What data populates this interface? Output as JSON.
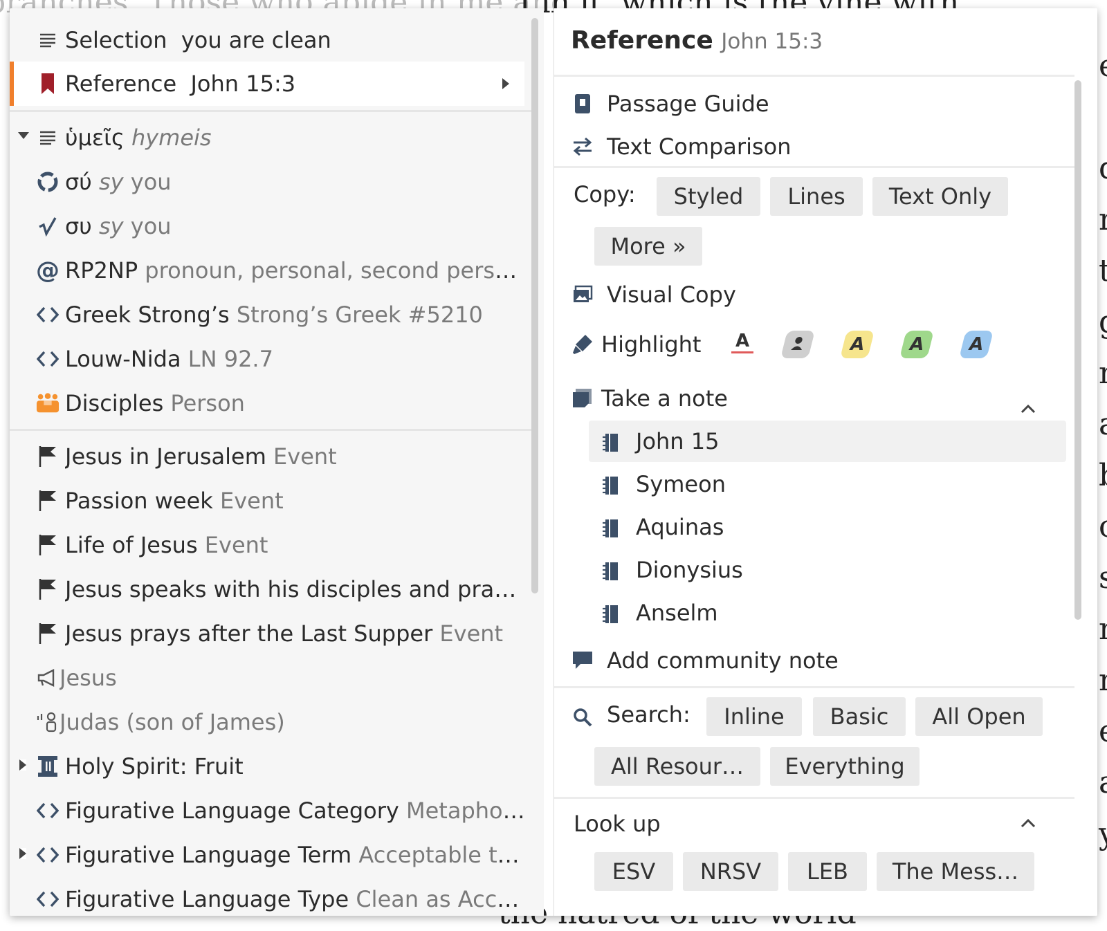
{
  "background": {
    "top_left": "branches. Those who abide in me and",
    "top_right": "I in it, which is the vine with",
    "bottom": "the hatred of the world",
    "right_letters": [
      "e",
      "",
      "d",
      "n",
      "t",
      "g",
      "n",
      "a",
      "b",
      "c",
      "s",
      "n",
      "n",
      "e",
      "a",
      "y"
    ]
  },
  "left_panel": {
    "header_items": [
      {
        "icon": "lines-icon",
        "label": "Selection",
        "secondary": "you are clean"
      },
      {
        "icon": "bookmark-icon",
        "label": "Reference",
        "secondary": "John 15:3",
        "has_submenu": true,
        "selected": true
      }
    ],
    "word_group": {
      "label": "ὑμεῖς",
      "secondary": "hymeis",
      "expanded": true,
      "items": [
        {
          "icon": "lemma-icon",
          "label": "σύ",
          "secondary": "sy",
          "gloss": "you"
        },
        {
          "icon": "root-icon",
          "label": "συ",
          "secondary": "sy",
          "gloss": "you"
        },
        {
          "icon": "at-icon",
          "label": "RP2NP",
          "secondary": "pronoun, personal, second person…"
        },
        {
          "icon": "code-icon",
          "label": "Greek Strong’s",
          "secondary": "Strong’s Greek #5210"
        },
        {
          "icon": "code-icon",
          "label": "Louw-Nida",
          "secondary": "LN 92.7"
        },
        {
          "icon": "people-icon",
          "label": "Disciples",
          "secondary": "Person"
        }
      ]
    },
    "events": [
      {
        "icon": "flag-icon",
        "label": "Jesus in Jerusalem",
        "secondary": "Event"
      },
      {
        "icon": "flag-icon",
        "label": "Passion week",
        "secondary": "Event"
      },
      {
        "icon": "flag-icon",
        "label": "Life of Jesus",
        "secondary": "Event"
      },
      {
        "icon": "flag-icon",
        "label": "Jesus speaks with his disciples and prays…",
        "secondary": ""
      },
      {
        "icon": "flag-icon",
        "label": "Jesus prays after the Last Supper",
        "secondary": "Event"
      }
    ],
    "others": [
      {
        "icon": "megaphone-icon",
        "label": "Jesus",
        "secondary": "",
        "muted": true
      },
      {
        "icon": "speaker-person-icon",
        "label": "Judas (son of James)",
        "secondary": "",
        "muted": true
      },
      {
        "icon": "pillar-icon",
        "label": "Holy Spirit: Fruit",
        "secondary": "",
        "collapsed": true
      },
      {
        "icon": "code-icon",
        "label": "Figurative Language Category",
        "secondary": "Metaphor,…"
      },
      {
        "icon": "code-icon",
        "label": "Figurative Language Term",
        "secondary": "Acceptable to…",
        "collapsed": true
      },
      {
        "icon": "code-icon",
        "label": "Figurative Language Type",
        "secondary": "Clean as Accept…"
      }
    ]
  },
  "right_panel": {
    "title": "Reference",
    "title_ref": "John 15:3",
    "passage_guide": "Passage Guide",
    "text_comparison": "Text Comparison",
    "copy": {
      "label": "Copy:",
      "buttons": [
        "Styled",
        "Lines",
        "Text Only",
        "More »"
      ]
    },
    "visual_copy": "Visual Copy",
    "highlight": {
      "label": "Highlight",
      "swatch_letter": "A",
      "swatches": [
        {
          "name": "underline",
          "color": "#e05a5a"
        },
        {
          "name": "person",
          "color": "#cfcfcf"
        },
        {
          "name": "yellow",
          "color": "#f6e58d"
        },
        {
          "name": "green",
          "color": "#9fd88b"
        },
        {
          "name": "blue",
          "color": "#9cc8f0"
        }
      ]
    },
    "take_note": {
      "label": "Take a note",
      "notebooks": [
        "John 15",
        "Symeon",
        "Aquinas",
        "Dionysius",
        "Anselm"
      ]
    },
    "community_note": "Add community note",
    "search": {
      "label": "Search:",
      "buttons": [
        "Inline",
        "Basic",
        "All Open",
        "All Resour…",
        "Everything"
      ]
    },
    "lookup": {
      "label": "Look up",
      "buttons": [
        "ESV",
        "NRSV",
        "LEB",
        "The Mess…"
      ]
    }
  },
  "colors": {
    "accent": "#f07f2c",
    "bookmark": "#a0202a",
    "people": "#f5922f",
    "selected_bg": "#ffffff"
  }
}
